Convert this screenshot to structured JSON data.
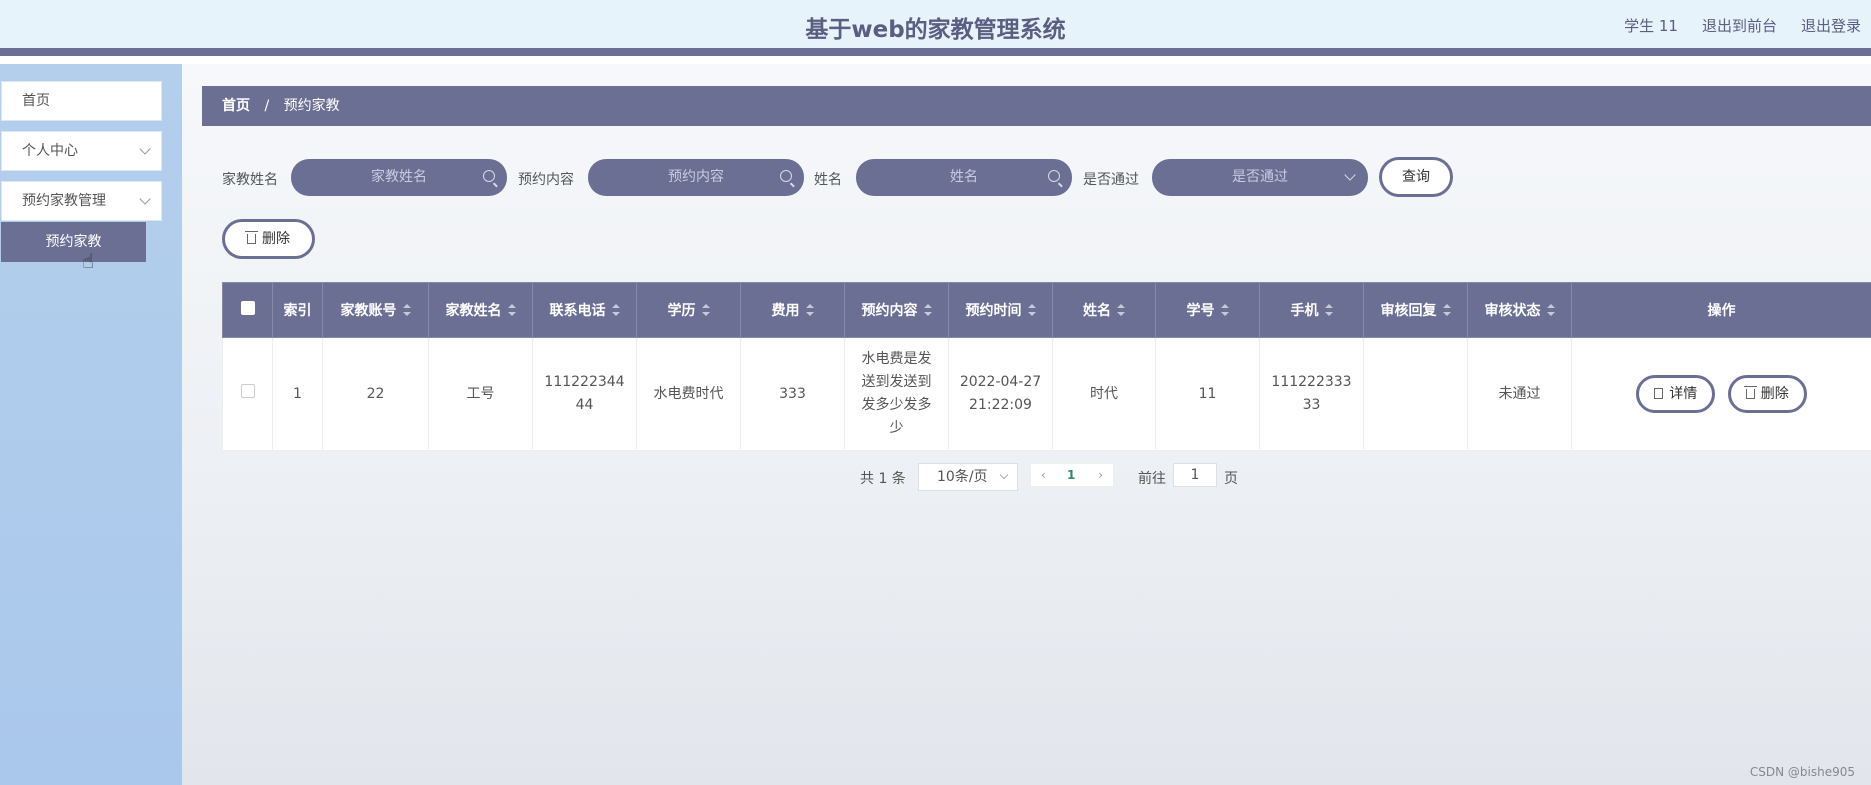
{
  "header": {
    "title": "基于web的家教管理系统",
    "user": "学生 11",
    "to_front": "退出到前台",
    "logout": "退出登录"
  },
  "sidebar": {
    "items": [
      {
        "label": "首页"
      },
      {
        "label": "个人中心"
      },
      {
        "label": "预约家教管理"
      }
    ],
    "sub_item": "预约家教"
  },
  "breadcrumb": {
    "home": "首页",
    "sep": "/",
    "current": "预约家教"
  },
  "search": {
    "tutor_name_label": "家教姓名",
    "tutor_name_placeholder": "家教姓名",
    "content_label": "预约内容",
    "content_placeholder": "预约内容",
    "name_label": "姓名",
    "name_placeholder": "姓名",
    "passed_label": "是否通过",
    "passed_placeholder": "是否通过",
    "query_button": "查询"
  },
  "toolbar": {
    "delete_label": "删除"
  },
  "table": {
    "headers": [
      "索引",
      "家教账号",
      "家教姓名",
      "联系电话",
      "学历",
      "费用",
      "预约内容",
      "预约时间",
      "姓名",
      "学号",
      "手机",
      "审核回复",
      "审核状态",
      "操作"
    ],
    "rows": [
      {
        "index": "1",
        "account": "22",
        "tutor_name": "工号",
        "phone_1": "111222344",
        "phone_2": "44",
        "education": "水电费时代",
        "fee": "333",
        "content_1": "水电费是发",
        "content_2": "送到发送到",
        "content_3": "发多少发多",
        "content_4": "少",
        "time_1": "2022-04-27",
        "time_2": "21:22:09",
        "name": "时代",
        "student_id": "11",
        "mobile_1": "111222333",
        "mobile_2": "33",
        "reply": "",
        "status": "未通过",
        "detail_label": "详情",
        "delete_label": "删除"
      }
    ]
  },
  "pagination": {
    "total": "共 1 条",
    "page_size": "10条/页",
    "prev": "‹",
    "current_page": "1",
    "next": "›",
    "goto_label": "前往",
    "goto_value": "1",
    "page_word": "页"
  },
  "watermark": "CSDN @bishe905"
}
